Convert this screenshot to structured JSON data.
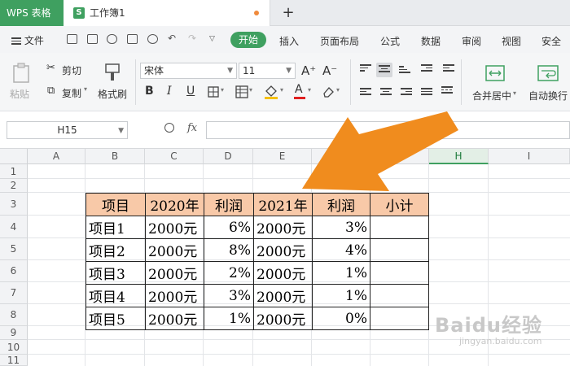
{
  "titlebar": {
    "app_name": "WPS 表格",
    "doc_icon": "S",
    "doc_title": "工作簿1",
    "new_tab": "+"
  },
  "menu": {
    "file": "文件",
    "tabs": [
      "开始",
      "插入",
      "页面布局",
      "公式",
      "数据",
      "审阅",
      "视图",
      "安全"
    ]
  },
  "ribbon": {
    "paste": "粘贴",
    "cut": "剪切",
    "copy": "复制",
    "format_painter": "格式刷",
    "font_name": "宋体",
    "font_size": "11",
    "grow_font": "A⁺",
    "shrink_font": "A⁻",
    "bold": "B",
    "italic": "I",
    "underline": "U",
    "font_color_letter": "A",
    "merge_center": "合并居中",
    "wrap_text": "自动换行"
  },
  "formula_bar": {
    "cell_ref": "H15",
    "fx": "fx",
    "formula": ""
  },
  "columns": [
    "A",
    "B",
    "C",
    "D",
    "E",
    "F",
    "G",
    "H",
    "I"
  ],
  "selected_column": "H",
  "rows": [
    "1",
    "2",
    "3",
    "4",
    "5",
    "6",
    "7",
    "8",
    "9",
    "10",
    "11"
  ],
  "table": {
    "headers": [
      "项目",
      "2020年",
      "利润",
      "2021年",
      "利润",
      "小计"
    ],
    "rows": [
      [
        "项目1",
        "2000元",
        "6%",
        "2000元",
        "3%",
        ""
      ],
      [
        "项目2",
        "2000元",
        "8%",
        "2000元",
        "4%",
        ""
      ],
      [
        "项目3",
        "2000元",
        "2%",
        "2000元",
        "1%",
        ""
      ],
      [
        "项目4",
        "2000元",
        "3%",
        "2000元",
        "1%",
        ""
      ],
      [
        "项目5",
        "2000元",
        "1%",
        "2000元",
        "0%",
        ""
      ]
    ]
  },
  "colors": {
    "accent_green": "#3fa060",
    "header_fill": "#f8c9a8",
    "arrow_orange": "#f08c1e"
  },
  "watermark": {
    "brand": "Baidu经验",
    "url": "jingyan.baidu.com"
  }
}
